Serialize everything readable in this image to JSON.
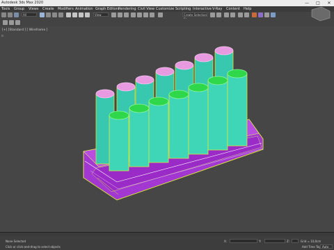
{
  "window": {
    "title": "Autodesk 3ds Max 2020",
    "minimize": "—",
    "maximize": "□",
    "close": "✕"
  },
  "menu": [
    "Tools",
    "Group",
    "Views",
    "Create",
    "Modifiers",
    "Animation",
    "Graph Editors",
    "Rendering",
    "Civil View",
    "Customize",
    "Scripting",
    "Interactive",
    "V-Ray",
    "Content",
    "Help"
  ],
  "toolbar": {
    "view_dropdown": "All",
    "coord_dropdown": "View",
    "selection_set": "Create Selection Se"
  },
  "viewport": {
    "label": "[+] [Standard ] [ Wireframe ]"
  },
  "status": {
    "selection": "None Selected",
    "prompt": "Click or click-and-drag to select objects",
    "x_label": "X:",
    "y_label": "Y:",
    "z_label": "Z:",
    "grid": "Grid = 10,0cm",
    "add_time_tag": "Add Time Tag",
    "auto_key": "Auto"
  },
  "colors": {
    "titlebar": "#ececec",
    "viewport": "#464646",
    "base": "#b23cd6",
    "tube": "#3fd0b0",
    "wire_yellow": "#d8e83a",
    "cap_green": "#2ed84a",
    "cap_pink": "#e79adf"
  }
}
